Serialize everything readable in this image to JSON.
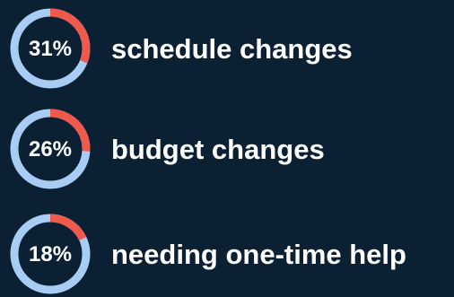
{
  "chart_data": {
    "type": "pie",
    "items": [
      {
        "value": 31,
        "percent_label": "31%",
        "label": "schedule changes"
      },
      {
        "value": 26,
        "percent_label": "26%",
        "label": "budget changes"
      },
      {
        "value": 18,
        "percent_label": "18%",
        "label": "needing one-time help"
      }
    ]
  },
  "colors": {
    "background": "#0b2133",
    "ring_track": "#a8cdf5",
    "ring_highlight": "#ef5a4c",
    "text": "#ffffff"
  }
}
